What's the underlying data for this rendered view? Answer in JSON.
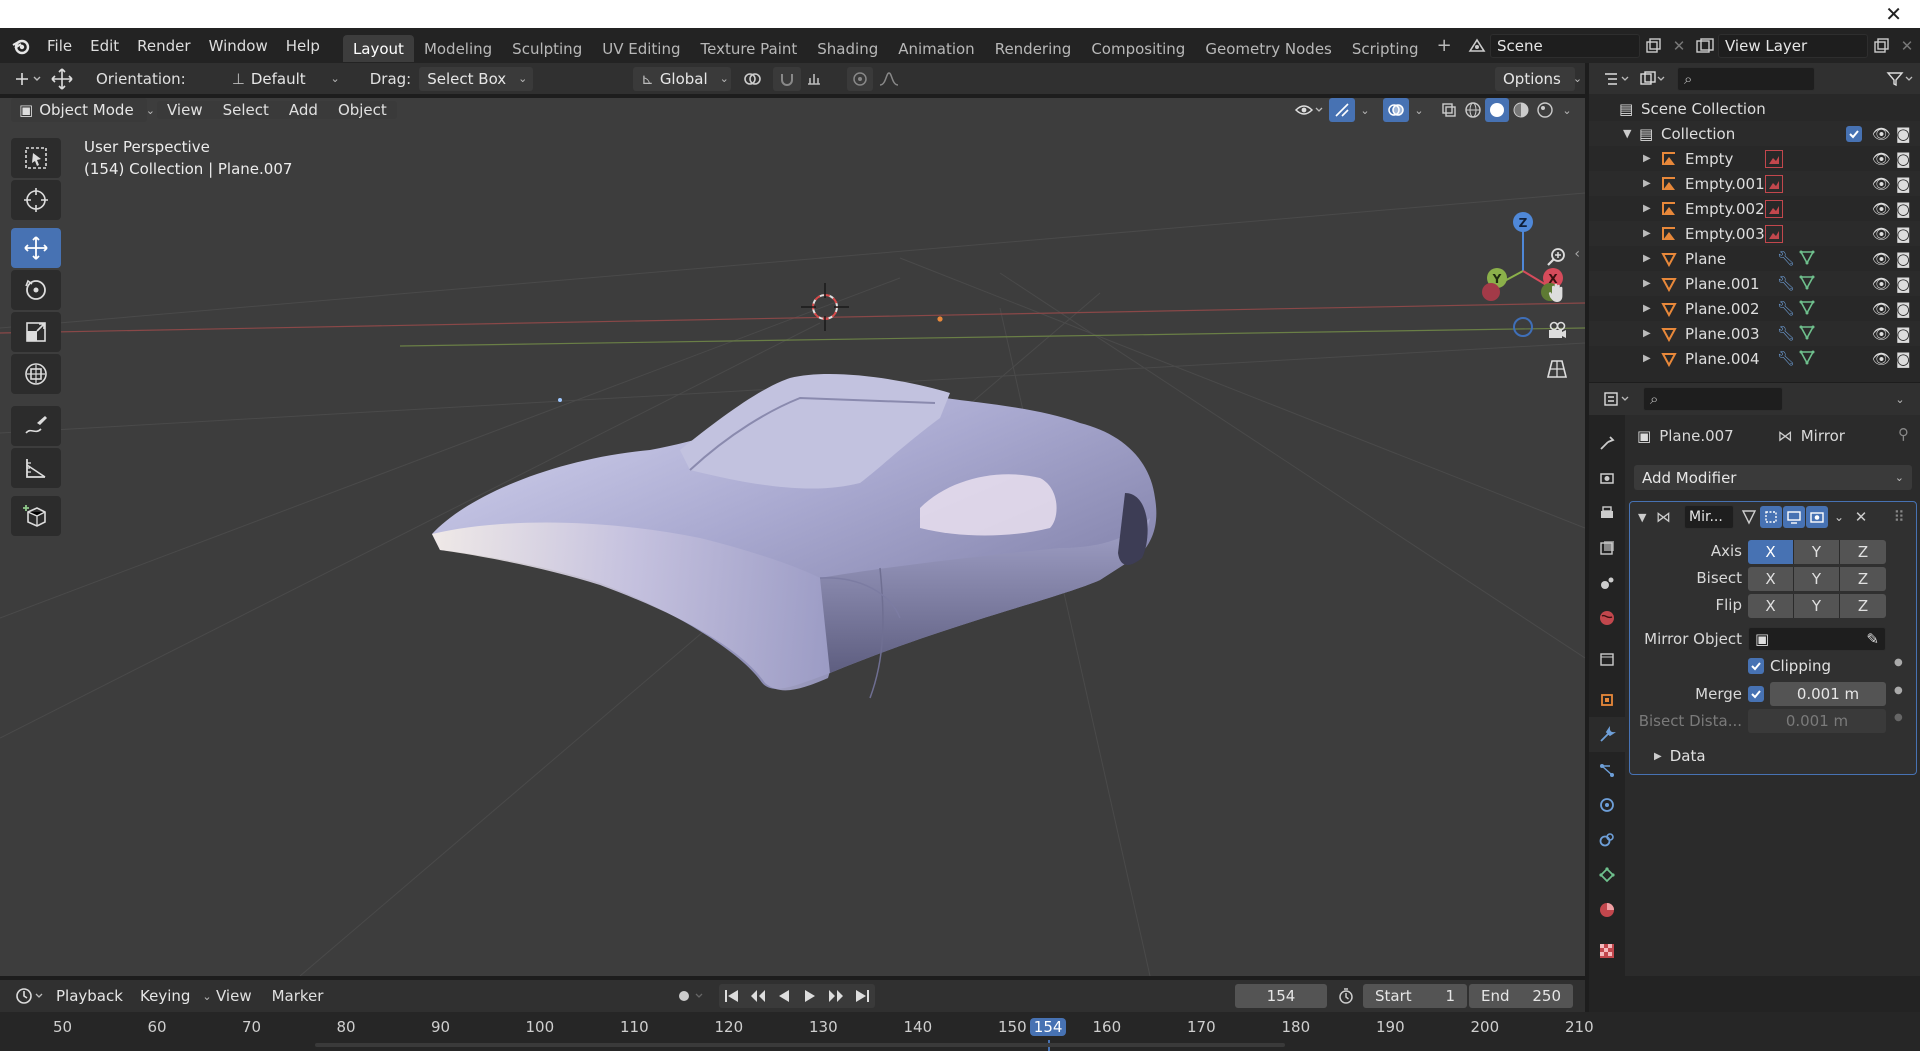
{
  "top_menu": [
    "File",
    "Edit",
    "Render",
    "Window",
    "Help"
  ],
  "workspaces": [
    "Layout",
    "Modeling",
    "Sculpting",
    "UV Editing",
    "Texture Paint",
    "Shading",
    "Animation",
    "Rendering",
    "Compositing",
    "Geometry Nodes",
    "Scripting"
  ],
  "active_workspace": "Layout",
  "scene": {
    "label": "Scene"
  },
  "view_layer": {
    "label": "View Layer"
  },
  "tool_header": {
    "orientation_label": "Orientation:",
    "orientation_value": "Default",
    "drag_label": "Drag:",
    "drag_value": "Select Box",
    "transform_orientation": "Global",
    "options_label": "Options"
  },
  "viewport_header": {
    "mode": "Object Mode",
    "menus": [
      "View",
      "Select",
      "Add",
      "Object"
    ]
  },
  "viewport": {
    "view_name": "User Perspective",
    "context": "(154) Collection | Plane.007",
    "gizmo": {
      "z": "Z",
      "y": "Y",
      "x": "X"
    }
  },
  "outliner": {
    "scene_collection": "Scene Collection",
    "collection": "Collection",
    "items": [
      {
        "name": "Empty",
        "type": "empty"
      },
      {
        "name": "Empty.001",
        "type": "empty"
      },
      {
        "name": "Empty.002",
        "type": "empty"
      },
      {
        "name": "Empty.003",
        "type": "empty"
      },
      {
        "name": "Plane",
        "type": "mesh"
      },
      {
        "name": "Plane.001",
        "type": "mesh"
      },
      {
        "name": "Plane.002",
        "type": "mesh"
      },
      {
        "name": "Plane.003",
        "type": "mesh"
      },
      {
        "name": "Plane.004",
        "type": "mesh"
      }
    ]
  },
  "properties": {
    "object_name": "Plane.007",
    "modifier_name": "Mirror",
    "add_modifier": "Add Modifier",
    "panel_name": "Mir...",
    "axis_label": "Axis",
    "bisect_label": "Bisect",
    "flip_label": "Flip",
    "axes": [
      "X",
      "Y",
      "Z"
    ],
    "mirror_object_label": "Mirror Object",
    "clipping_label": "Clipping",
    "merge_label": "Merge",
    "merge_value": "0.001 m",
    "bisect_distance_label": "Bisect Dista...",
    "bisect_distance_value": "0.001 m",
    "data_label": "Data"
  },
  "timeline": {
    "menus": [
      "Playback",
      "Keying",
      "View",
      "Marker"
    ],
    "current_frame": "154",
    "start_label": "Start",
    "start_value": "1",
    "end_label": "End",
    "end_value": "250",
    "ruler": [
      "50",
      "60",
      "70",
      "80",
      "90",
      "100",
      "110",
      "120",
      "130",
      "140",
      "150",
      "154",
      "160",
      "170",
      "180",
      "190",
      "200",
      "210"
    ]
  },
  "colors": {
    "accent": "#4772b3",
    "object_orange": "#e8883a",
    "mesh_green": "#6fc08d",
    "modifier_blue": "#6e9fd8"
  }
}
